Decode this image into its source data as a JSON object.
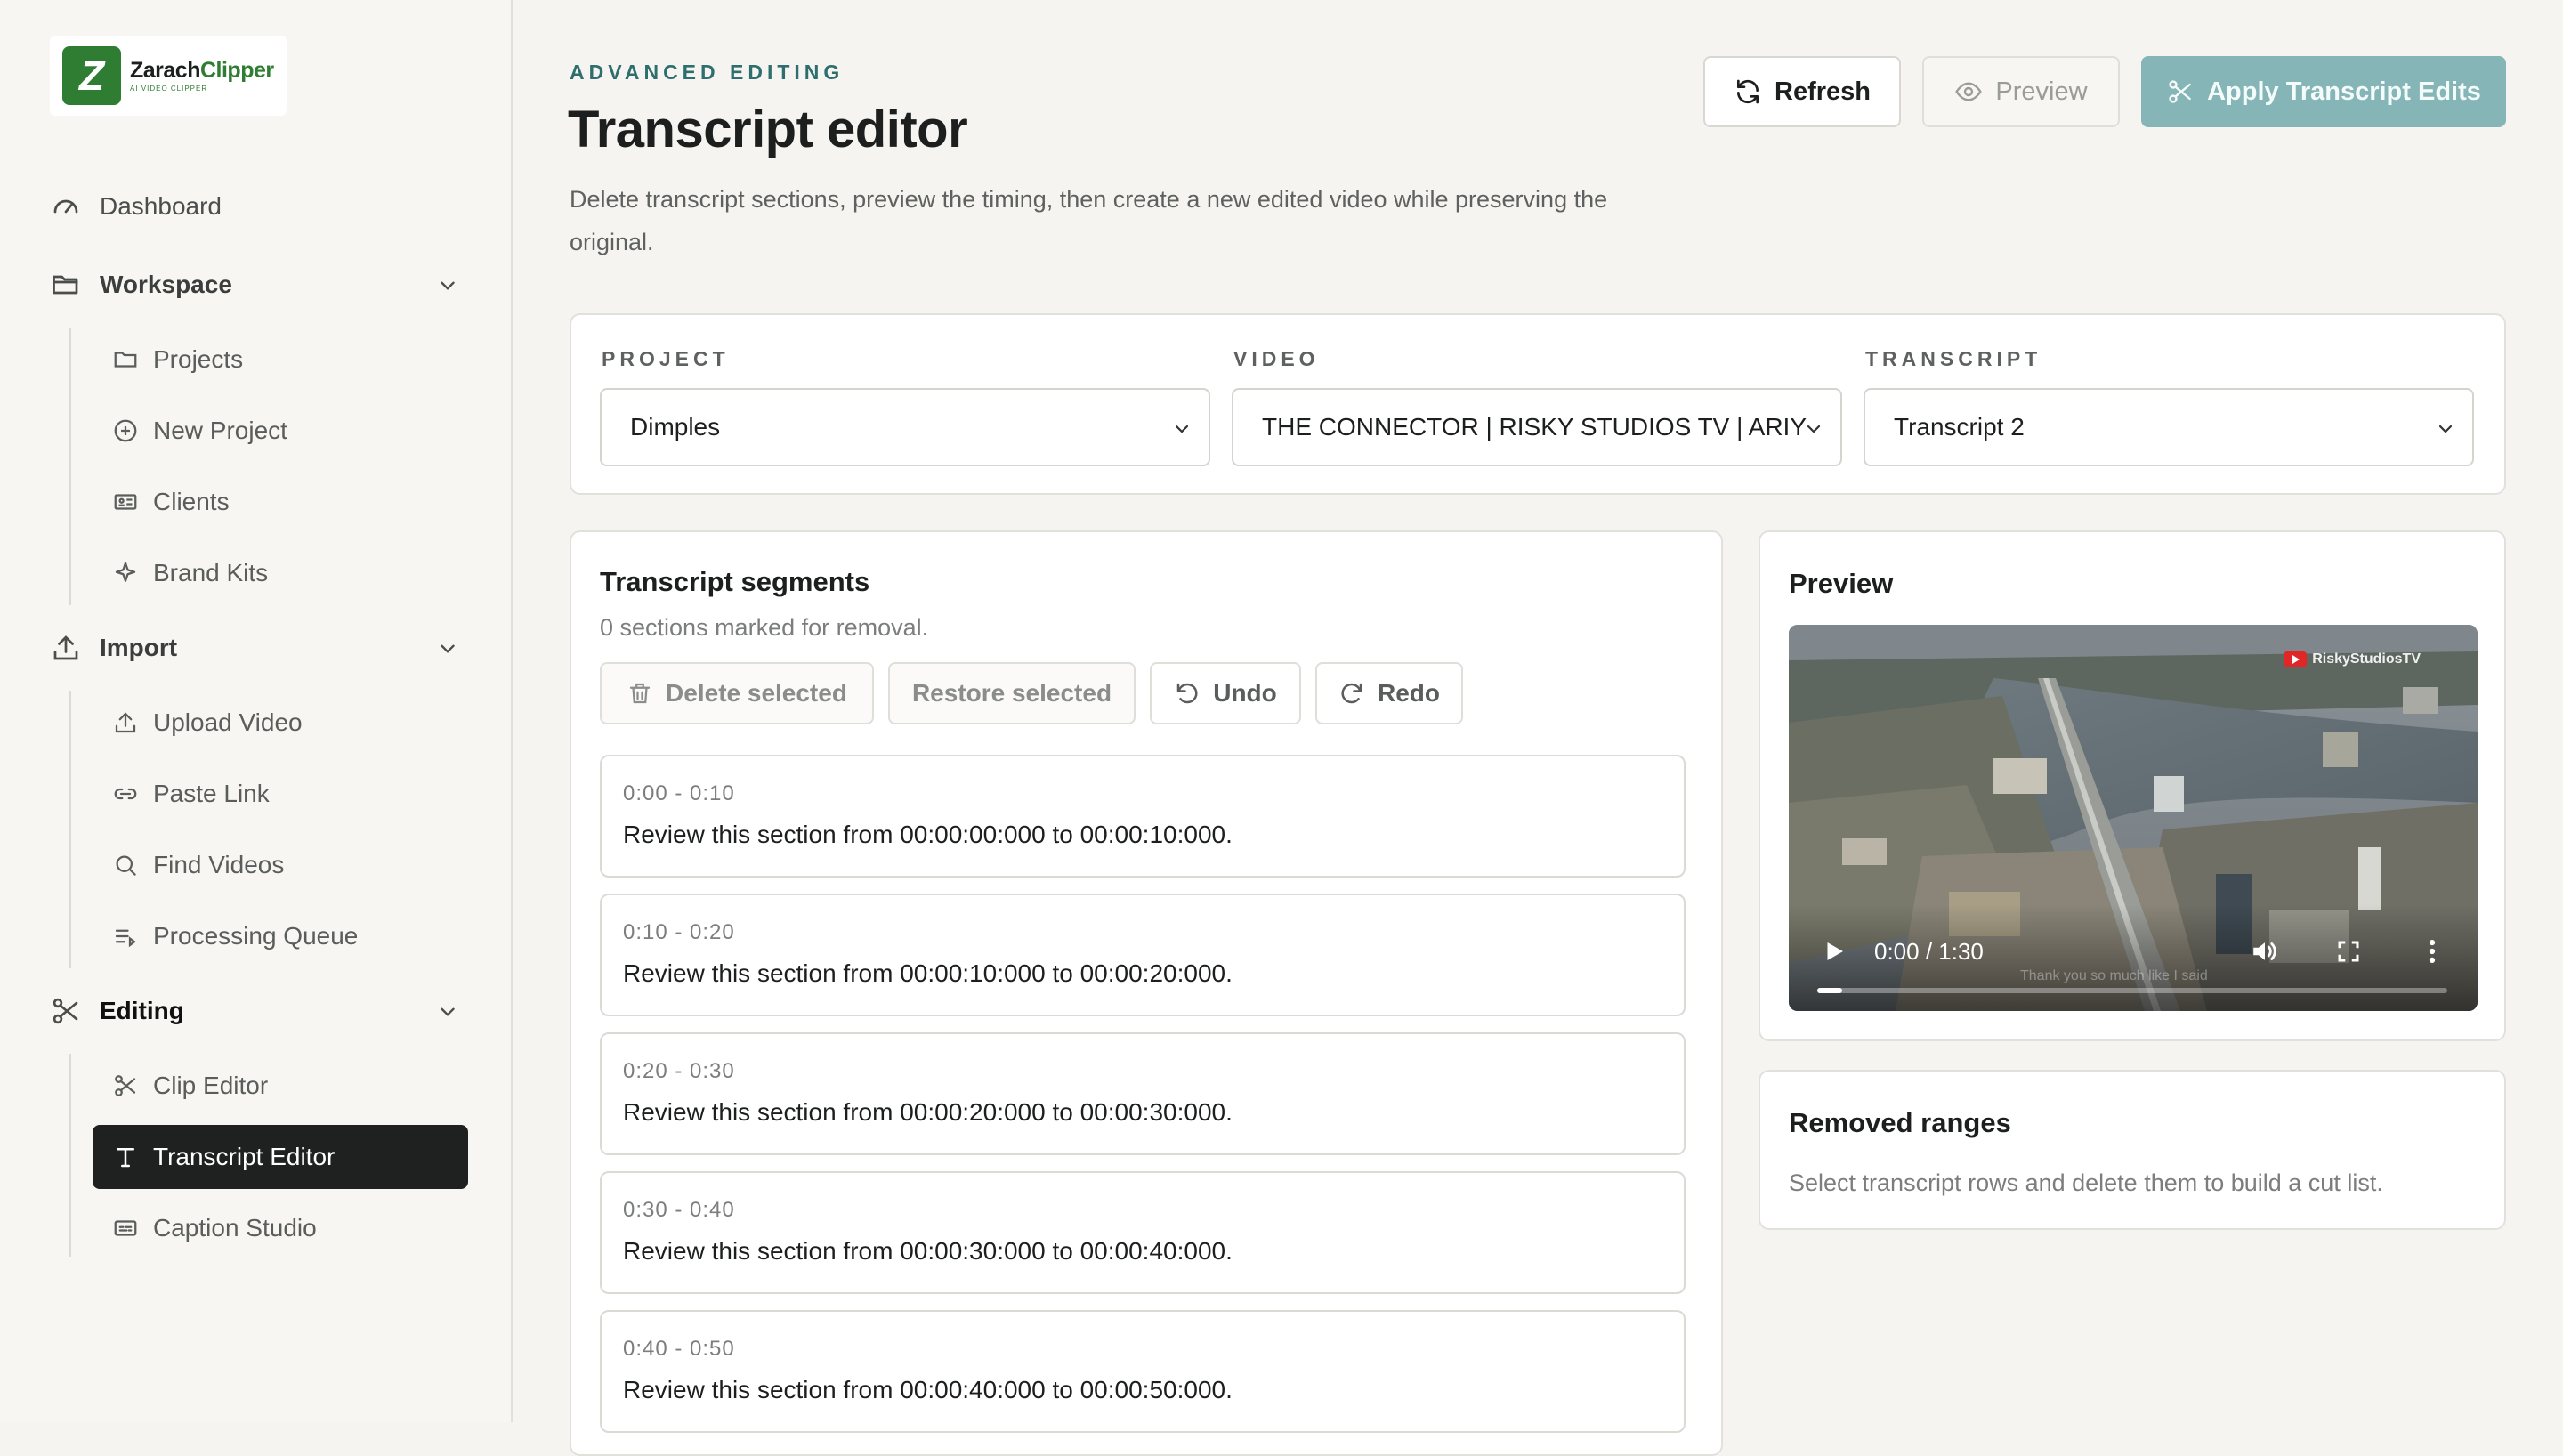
{
  "brand": {
    "name_part1": "Zarach",
    "name_part2": "Clipper",
    "tagline": "AI VIDEO CLIPPER",
    "accent": "#2f7d32"
  },
  "sidebar": {
    "dashboard": "Dashboard",
    "workspace": {
      "label": "Workspace",
      "items": [
        "Projects",
        "New Project",
        "Clients",
        "Brand Kits"
      ]
    },
    "import": {
      "label": "Import",
      "items": [
        "Upload Video",
        "Paste Link",
        "Find Videos",
        "Processing Queue"
      ]
    },
    "editing": {
      "label": "Editing",
      "items": [
        "Clip Editor",
        "Transcript Editor",
        "Caption Studio"
      ],
      "active": "Transcript Editor"
    }
  },
  "header": {
    "eyebrow": "ADVANCED EDITING",
    "title": "Transcript editor",
    "description": "Delete transcript sections, preview the timing, then create a new edited video while preserving the original.",
    "refresh_label": "Refresh",
    "preview_label": "Preview",
    "apply_label": "Apply Transcript Edits"
  },
  "selectors": {
    "project": {
      "label": "PROJECT",
      "value": "Dimples"
    },
    "video": {
      "label": "VIDEO",
      "value": "THE CONNECTOR | RISKY STUDIOS TV | ARIY"
    },
    "transcript": {
      "label": "TRANSCRIPT",
      "value": "Transcript 2"
    }
  },
  "segments": {
    "title": "Transcript segments",
    "count_text": "0 sections marked for removal.",
    "delete_label": "Delete selected",
    "restore_label": "Restore selected",
    "undo_label": "Undo",
    "redo_label": "Redo",
    "items": [
      {
        "time": "0:00 - 0:10",
        "text": "Review this section from 00:00:00:000 to 00:00:10:000."
      },
      {
        "time": "0:10 - 0:20",
        "text": "Review this section from 00:00:10:000 to 00:00:20:000."
      },
      {
        "time": "0:20 - 0:30",
        "text": "Review this section from 00:00:20:000 to 00:00:30:000."
      },
      {
        "time": "0:30 - 0:40",
        "text": "Review this section from 00:00:30:000 to 00:00:40:000."
      },
      {
        "time": "0:40 - 0:50",
        "text": "Review this section from 00:00:40:000 to 00:00:50:000."
      }
    ]
  },
  "preview": {
    "title": "Preview",
    "watermark": "RiskyStudiosTV",
    "time": "0:00 / 1:30",
    "caption": "Thank you so much like I said",
    "progress_fraction": 0.04
  },
  "removed": {
    "title": "Removed ranges",
    "empty_text": "Select transcript rows and delete them to build a cut list."
  }
}
